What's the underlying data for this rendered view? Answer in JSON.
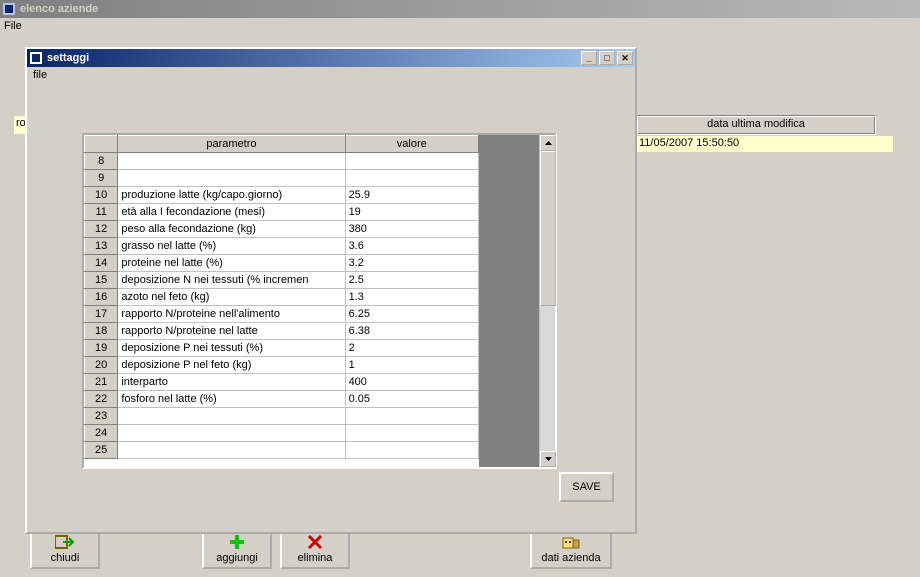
{
  "outer_window": {
    "title": "elenco aziende",
    "menu_file": "File"
  },
  "bg": {
    "left_row_value": "ro",
    "right_header_label": "data ultima modifica",
    "right_value": "11/05/2007 15:50:50"
  },
  "modal": {
    "title": "settaggi",
    "menu_file": "file",
    "save_label": "SAVE",
    "minimize": "_",
    "maximize": "□",
    "close": "✕"
  },
  "grid": {
    "header_param": "parametro",
    "header_value": "valore",
    "rows": [
      {
        "n": "8",
        "param": "",
        "value": ""
      },
      {
        "n": "9",
        "param": "",
        "value": ""
      },
      {
        "n": "10",
        "param": "produzione latte (kg/capo.giorno)",
        "value": "25.9"
      },
      {
        "n": "11",
        "param": "età alla I fecondazione (mesi)",
        "value": "19"
      },
      {
        "n": "12",
        "param": "peso alla fecondazione (kg)",
        "value": "380"
      },
      {
        "n": "13",
        "param": "grasso nel latte (%)",
        "value": "3.6"
      },
      {
        "n": "14",
        "param": "proteine nel latte (%)",
        "value": "3.2"
      },
      {
        "n": "15",
        "param": "deposizione N nei tessuti (% incremen",
        "value": "2.5"
      },
      {
        "n": "16",
        "param": "azoto nel feto (kg)",
        "value": "1.3"
      },
      {
        "n": "17",
        "param": "rapporto N/proteine nell'alimento",
        "value": "6.25"
      },
      {
        "n": "18",
        "param": "rapporto N/proteine nel latte",
        "value": "6.38"
      },
      {
        "n": "19",
        "param": "deposizione P nei tessuti (%)",
        "value": "2"
      },
      {
        "n": "20",
        "param": "deposizione P nel feto (kg)",
        "value": "1"
      },
      {
        "n": "21",
        "param": "interparto",
        "value": "400"
      },
      {
        "n": "22",
        "param": "fosforo nel latte (%)",
        "value": "0.05"
      },
      {
        "n": "23",
        "param": "",
        "value": ""
      },
      {
        "n": "24",
        "param": "",
        "value": ""
      },
      {
        "n": "25",
        "param": "",
        "value": ""
      }
    ]
  },
  "toolbar": {
    "chiudi": "chiudi",
    "aggiungi": "aggiungi",
    "elimina": "elimina",
    "dati_azienda": "dati azienda"
  }
}
